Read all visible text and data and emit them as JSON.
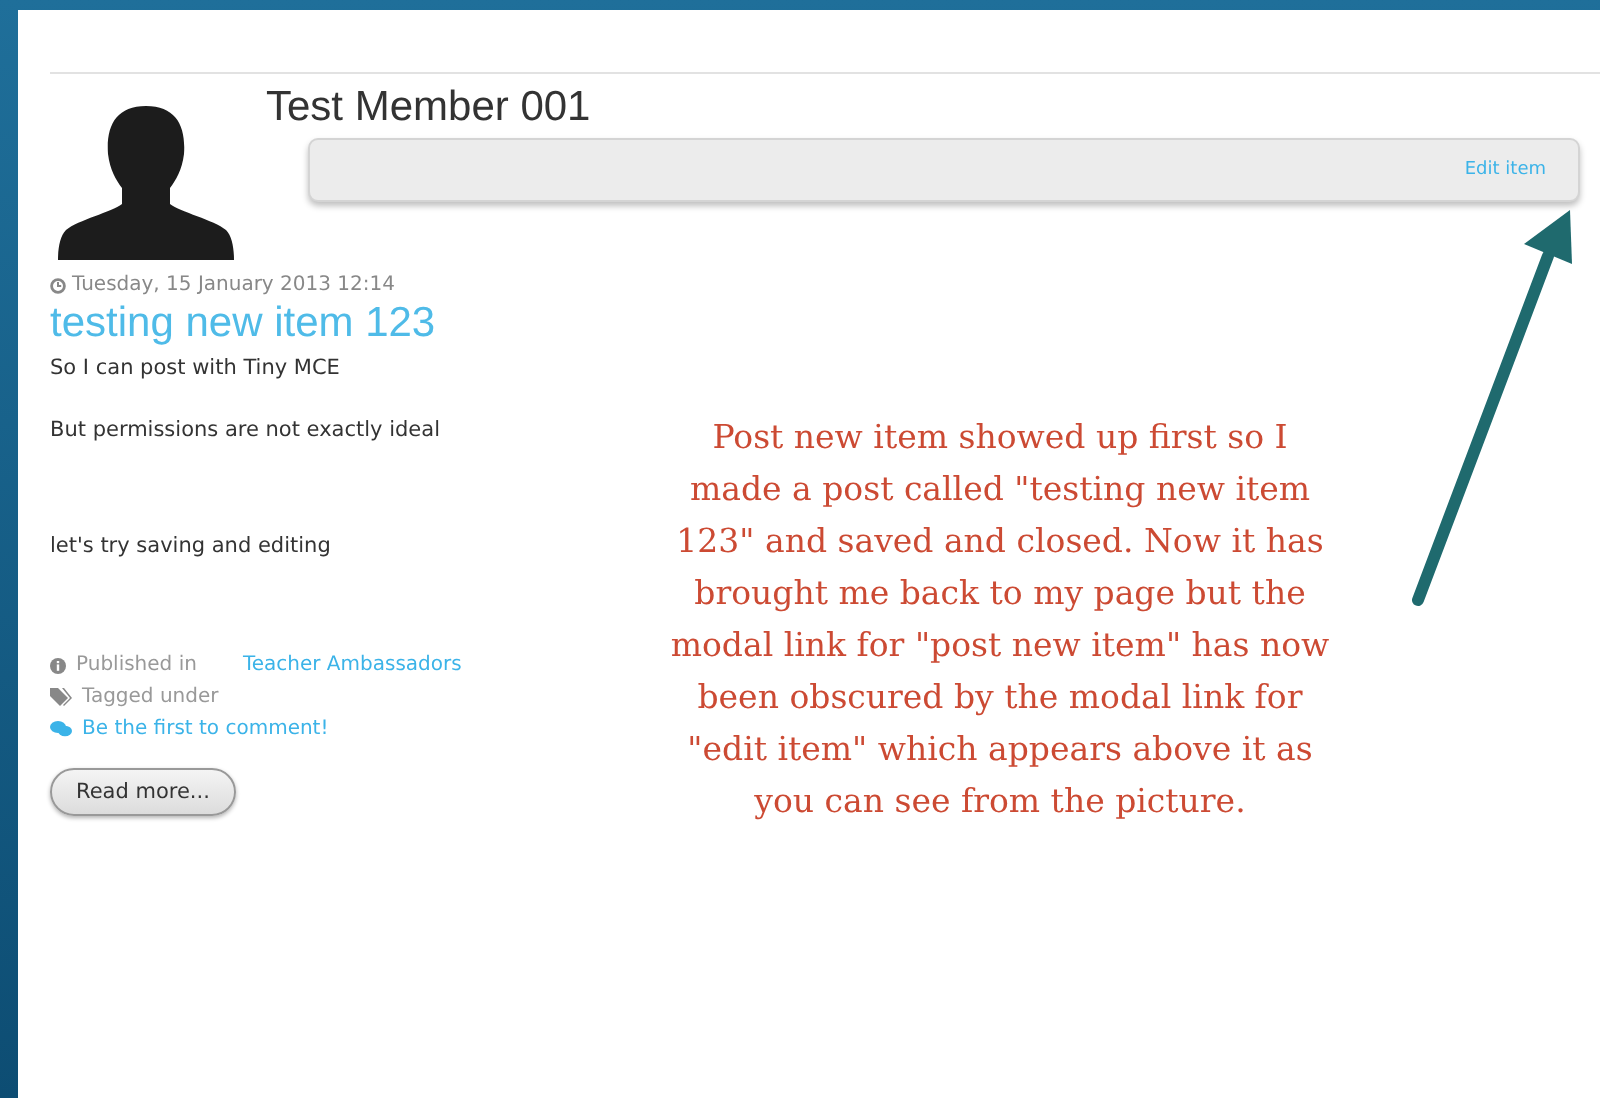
{
  "profile": {
    "name": "Test Member 001"
  },
  "toolbar": {
    "link": "Edit item"
  },
  "post": {
    "date": "Tuesday, 15 January 2013 12:14",
    "title": "testing new item 123",
    "paragraphs": [
      "So I can post with Tiny MCE",
      "But permissions are not exactly ideal",
      "let's try saving and editing"
    ],
    "meta": [
      {
        "kind": "category",
        "label": "Published in",
        "link": "Teacher Ambassadors"
      },
      {
        "kind": "tags",
        "label": "Tagged under"
      },
      {
        "kind": "comments",
        "link": "Be the first to comment!"
      }
    ],
    "button": "Read more..."
  },
  "annotation": {
    "lines": [
      "Post new item showed up first so I",
      "made a post called \"testing new item",
      "123\" and saved and closed. Now it has",
      "brought me back to my page but the",
      "modal link for \"post new item\" has now",
      "been obscured by the modal link for",
      "\"edit item\" which appears above it as",
      "you can see from the picture."
    ]
  }
}
